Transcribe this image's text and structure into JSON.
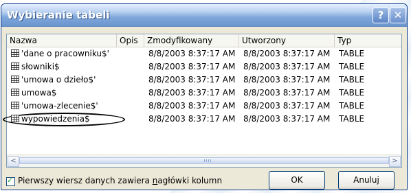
{
  "dialog": {
    "title": "Wybieranie tabeli",
    "help_glyph": "?",
    "close_glyph": "✕"
  },
  "list": {
    "columns": [
      "Nazwa",
      "Opis",
      "Zmodyfikowany",
      "Utworzony",
      "Typ"
    ],
    "rows": [
      {
        "name": "'dane o pracowniku$'",
        "modified": "8/8/2003 8:37:17 AM",
        "created": "8/8/2003 8:37:17 AM",
        "type": "TABLE"
      },
      {
        "name": "słowniki$",
        "modified": "8/8/2003 8:37:17 AM",
        "created": "8/8/2003 8:37:17 AM",
        "type": "TABLE"
      },
      {
        "name": "'umowa o dzieło$'",
        "modified": "8/8/2003 8:37:17 AM",
        "created": "8/8/2003 8:37:17 AM",
        "type": "TABLE"
      },
      {
        "name": "umowa$",
        "modified": "8/8/2003 8:37:17 AM",
        "created": "8/8/2003 8:37:17 AM",
        "type": "TABLE"
      },
      {
        "name": "'umowa-zlecenie$'",
        "modified": "8/8/2003 8:37:17 AM",
        "created": "8/8/2003 8:37:17 AM",
        "type": "TABLE"
      },
      {
        "name": "wypowiedzenia$",
        "modified": "8/8/2003 8:37:17 AM",
        "created": "8/8/2003 8:37:17 AM",
        "type": "TABLE"
      }
    ],
    "highlighted_row_index": 5,
    "scroll_left_glyph": "<",
    "scroll_right_glyph": ">"
  },
  "options": {
    "header_checkbox_label_pre": "Pierwszy wiersz danych zawiera ",
    "header_checkbox_label_accel": "n",
    "header_checkbox_label_post": "agłówki kolumn",
    "header_checkbox_checked": true
  },
  "buttons": {
    "ok": "OK",
    "cancel": "Anuluj"
  }
}
